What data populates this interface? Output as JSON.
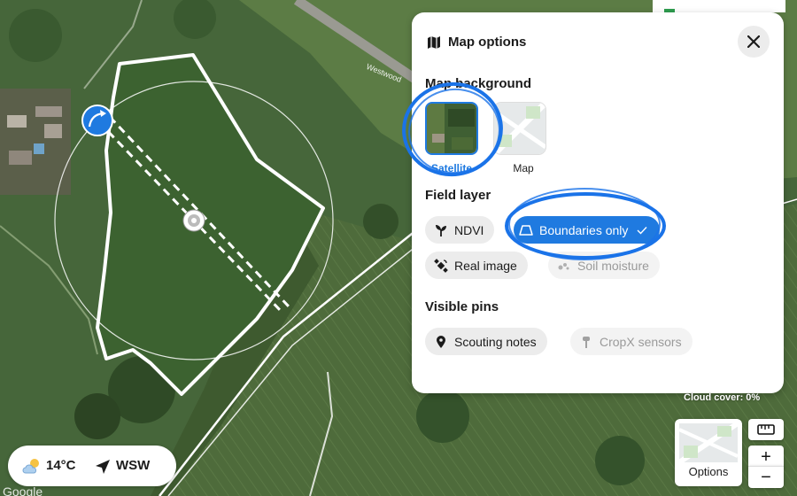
{
  "options_panel": {
    "title": "Map options",
    "close_icon": "close-icon",
    "map_background": {
      "title": "Map background",
      "options": [
        {
          "label": "Satellite",
          "selected": true
        },
        {
          "label": "Map",
          "selected": false
        }
      ]
    },
    "field_layer": {
      "title": "Field layer",
      "chips": [
        {
          "label": "NDVI",
          "state": "enabled"
        },
        {
          "label": "Boundaries only",
          "state": "selected"
        },
        {
          "label": "Real image",
          "state": "enabled"
        },
        {
          "label": "Soil moisture",
          "state": "disabled"
        }
      ]
    },
    "visible_pins": {
      "title": "Visible pins",
      "chips": [
        {
          "label": "Scouting notes",
          "state": "enabled"
        },
        {
          "label": "CropX sensors",
          "state": "disabled"
        }
      ]
    }
  },
  "weather": {
    "temperature": "14°C",
    "wind": "WSW"
  },
  "map_info": {
    "cloud_cover": "Cloud cover: 0%",
    "attribution": "Google",
    "road_name": "Westwood"
  },
  "controls": {
    "options_label": "Options",
    "zoom_in": "+",
    "zoom_out": "−"
  },
  "colors": {
    "accent": "#1f7ae0",
    "annotation": "#1a73e8"
  }
}
